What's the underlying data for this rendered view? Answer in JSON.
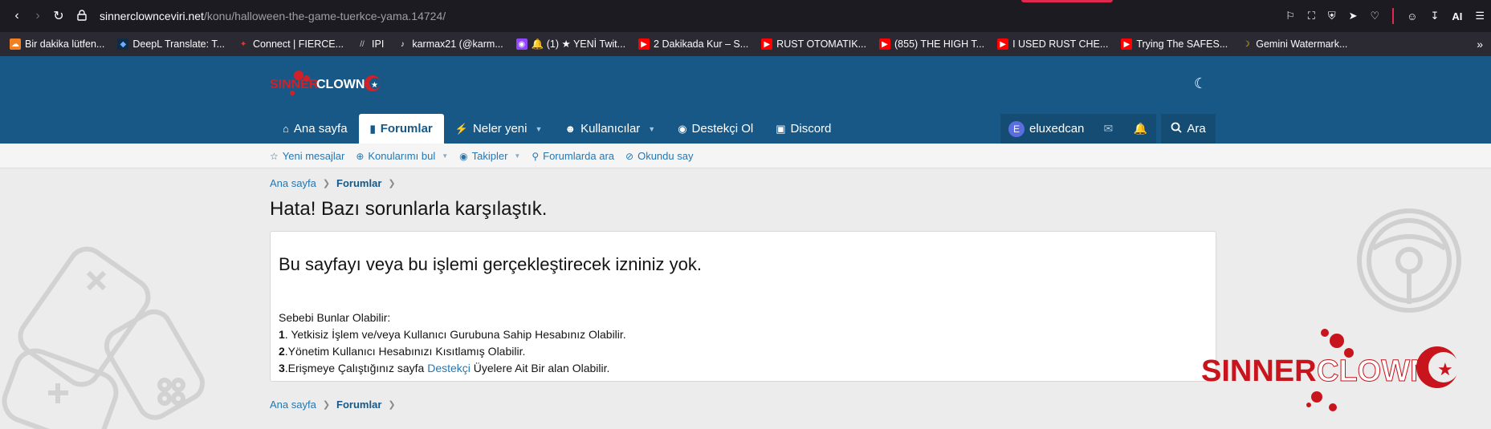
{
  "browser": {
    "url_host": "sinnerclownceviri.net",
    "url_path": "/konu/halloween-the-game-tuerkce-yama.14724/",
    "toolbar_icons": [
      "pocket-icon",
      "screenshot-icon",
      "shield-icon",
      "send-icon",
      "heart-icon",
      "account-icon",
      "download-icon"
    ],
    "ai_label": "AI",
    "bookmarks": [
      {
        "label": "Bir dakika lütfen...",
        "icon": "cloudflare-icon"
      },
      {
        "label": "DeepL Translate: T...",
        "icon": "deepl-icon"
      },
      {
        "label": "Connect | FIERCE...",
        "icon": "fierce-icon"
      },
      {
        "label": "IPI",
        "icon": "ipi-icon"
      },
      {
        "label": "karmax21 (@karm...",
        "icon": "tiktok-icon"
      },
      {
        "label": "🔔 (1) ★ YENİ Twit...",
        "icon": "twitch-icon"
      },
      {
        "label": "2 Dakikada Kur – S...",
        "icon": "youtube-icon"
      },
      {
        "label": "RUST OTOMATIK...",
        "icon": "youtube-icon"
      },
      {
        "label": "(855) THE HIGH T...",
        "icon": "youtube-icon"
      },
      {
        "label": "I USED RUST CHE...",
        "icon": "youtube-icon"
      },
      {
        "label": "Trying The SAFES...",
        "icon": "youtube-icon"
      },
      {
        "label": "Gemini Watermark...",
        "icon": "banana-icon"
      }
    ]
  },
  "header": {
    "nav": [
      {
        "label": "Ana sayfa",
        "icon": "home-icon",
        "active": false,
        "caret": false
      },
      {
        "label": "Forumlar",
        "icon": "comment-icon",
        "active": true,
        "caret": false
      },
      {
        "label": "Neler yeni",
        "icon": "bolt-icon",
        "active": false,
        "caret": true
      },
      {
        "label": "Kullanıcılar",
        "icon": "users-icon",
        "active": false,
        "caret": true
      },
      {
        "label": "Destekçi Ol",
        "icon": "badge-icon",
        "active": false,
        "caret": false
      },
      {
        "label": "Discord",
        "icon": "discord-icon",
        "active": false,
        "caret": false
      }
    ],
    "user": {
      "avatar_letter": "E",
      "name": "eluxedcan"
    },
    "search_label": "Ara"
  },
  "subnav": [
    {
      "label": "Yeni mesajlar",
      "icon": "star-icon",
      "caret": false
    },
    {
      "label": "Konularımı bul",
      "icon": "search-plus-icon",
      "caret": true
    },
    {
      "label": "Takipler",
      "icon": "eye-icon",
      "caret": true
    },
    {
      "label": "Forumlarda ara",
      "icon": "search-icon",
      "caret": false
    },
    {
      "label": "Okundu say",
      "icon": "eye-slash-icon",
      "caret": false
    }
  ],
  "breadcrumb": {
    "home": "Ana sayfa",
    "forums": "Forumlar"
  },
  "content": {
    "title": "Hata! Bazı sorunlarla karşılaştık.",
    "error_heading": "Bu sayfayı veya bu işlemi gerçekleştirecek izniniz yok.",
    "reasons_intro": "Sebebi Bunlar Olabilir:",
    "reason1_num": "1",
    "reason1_text": ". Yetkisiz İşlem ve/veya Kullanıcı Gurubuna Sahip Hesabınız Olabilir.",
    "reason2_num": "2",
    "reason2_text": ".Yönetim Kullanıcı Hesabınızı Kısıtlamış Olabilir.",
    "reason3_num": "3",
    "reason3_pre": ".Erişmeye Çalıştığınız sayfa ",
    "reason3_link": "Destekçi",
    "reason3_post": " Üyelere Ait Bir alan Olabilir."
  },
  "colors": {
    "header_bg": "#185886",
    "link": "#2577b1",
    "brand_red": "#d32027"
  }
}
